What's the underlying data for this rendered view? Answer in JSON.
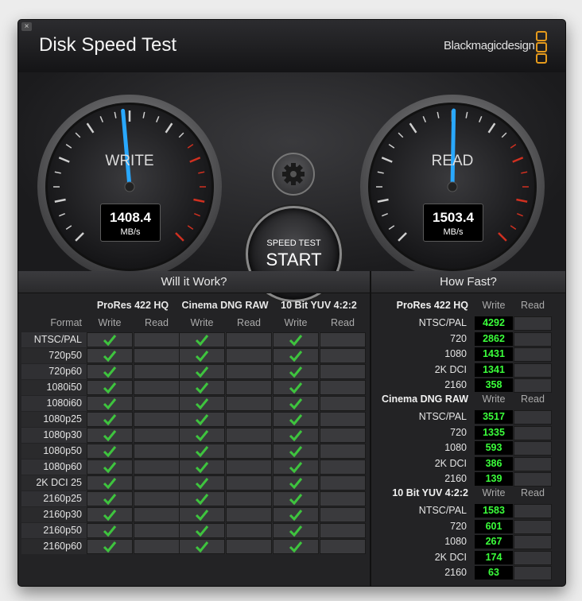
{
  "window": {
    "close_glyph": "×"
  },
  "app": {
    "title": "Disk Speed Test",
    "brand": "Blackmagicdesign"
  },
  "gauges": {
    "write": {
      "label": "WRITE",
      "value": "1408.4",
      "unit": "MB/s"
    },
    "read": {
      "label": "READ",
      "value": "1503.4",
      "unit": "MB/s"
    }
  },
  "start_button": {
    "sub": "SPEED TEST",
    "label": "START"
  },
  "will_it_work": {
    "title": "Will it Work?",
    "format_label": "Format",
    "groups": [
      "ProRes 422 HQ",
      "Cinema DNG RAW",
      "10 Bit YUV 4:2:2"
    ],
    "write_label": "Write",
    "read_label": "Read",
    "formats": [
      "NTSC/PAL",
      "720p50",
      "720p60",
      "1080i50",
      "1080i60",
      "1080p25",
      "1080p30",
      "1080p50",
      "1080p60",
      "2K DCI 25",
      "2160p25",
      "2160p30",
      "2160p50",
      "2160p60"
    ]
  },
  "how_fast": {
    "title": "How Fast?",
    "write_label": "Write",
    "read_label": "Read",
    "groups": [
      {
        "name": "ProRes 422 HQ",
        "rows": [
          "NTSC/PAL",
          "720",
          "1080",
          "2K DCI",
          "2160"
        ],
        "write": [
          "4292",
          "2862",
          "1431",
          "1341",
          "358"
        ]
      },
      {
        "name": "Cinema DNG RAW",
        "rows": [
          "NTSC/PAL",
          "720",
          "1080",
          "2K DCI",
          "2160"
        ],
        "write": [
          "3517",
          "1335",
          "593",
          "386",
          "139"
        ]
      },
      {
        "name": "10 Bit YUV 4:2:2",
        "rows": [
          "NTSC/PAL",
          "720",
          "1080",
          "2K DCI",
          "2160"
        ],
        "write": [
          "1583",
          "601",
          "267",
          "174",
          "63"
        ]
      }
    ]
  },
  "colors": {
    "fast_value": "#3bff3b",
    "check": "#3ec43e",
    "needle": "#29a8ff",
    "brand_accent": "#e59a1c"
  }
}
